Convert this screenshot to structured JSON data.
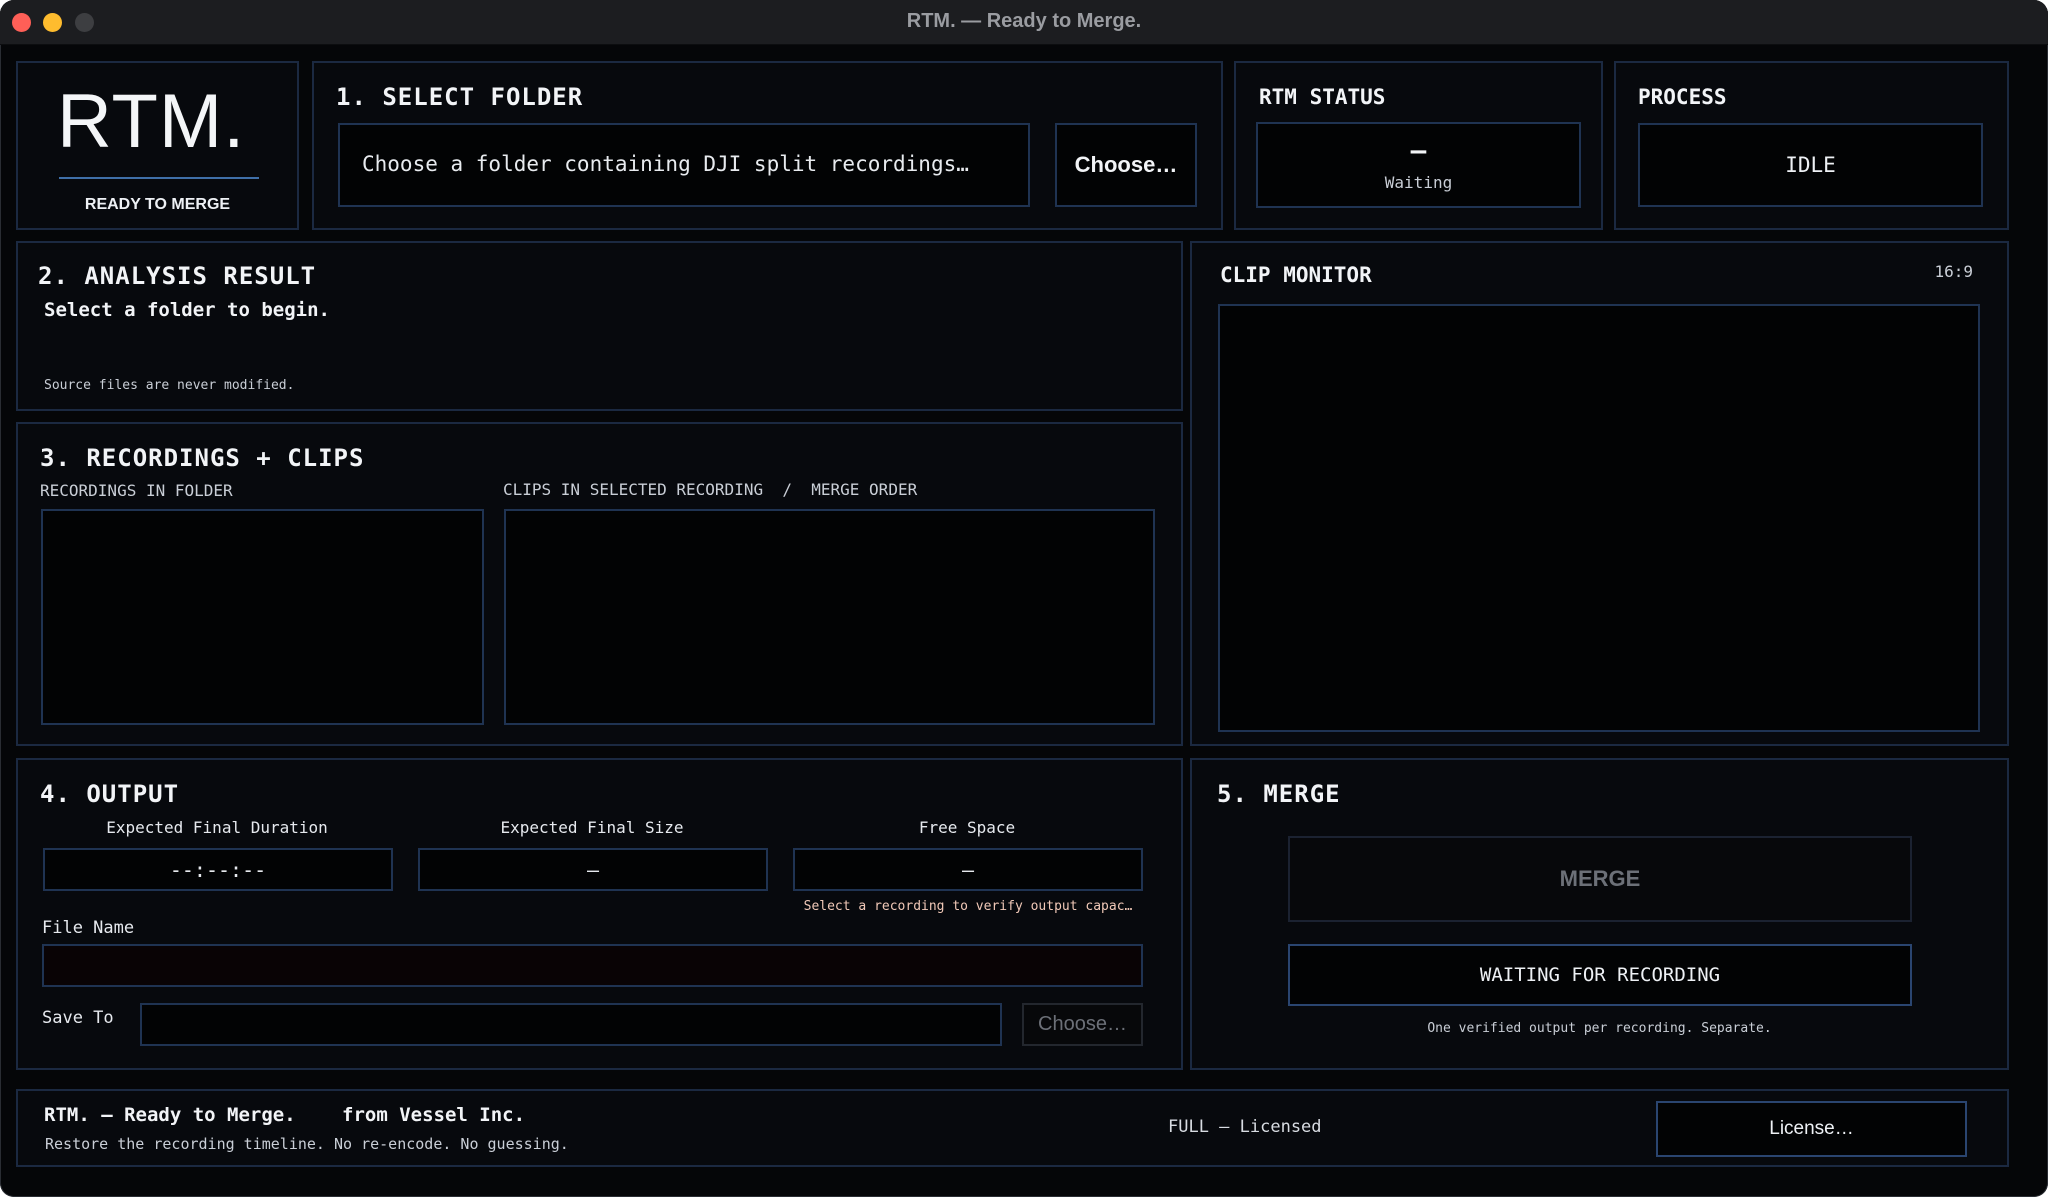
{
  "window": {
    "title": "RTM. — Ready to Merge."
  },
  "logo": {
    "wordmark": "RTM.",
    "tagline": "READY TO MERGE"
  },
  "select_folder": {
    "title": "1. SELECT FOLDER",
    "placeholder": "Choose a folder containing DJI split recordings…",
    "choose_label": "Choose…"
  },
  "rtm_status": {
    "title": "RTM STATUS",
    "value": "–",
    "caption": "Waiting"
  },
  "process": {
    "title": "PROCESS",
    "value": "IDLE"
  },
  "analysis": {
    "title": "2. ANALYSIS RESULT",
    "message": "Select a folder to begin.",
    "note": "Source files are never modified."
  },
  "clip_monitor": {
    "title": "CLIP MONITOR",
    "aspect": "16:9"
  },
  "recordings": {
    "title": "3. RECORDINGS + CLIPS",
    "recordings_label": "RECORDINGS IN FOLDER",
    "clips_label": "CLIPS IN SELECTED RECORDING  /  MERGE ORDER"
  },
  "output": {
    "title": "4. OUTPUT",
    "duration_label": "Expected Final Duration",
    "duration_value": "--:--:--",
    "size_label": "Expected Final Size",
    "size_value": "–",
    "free_label": "Free Space",
    "free_value": "–",
    "capacity_note": "Select a recording to verify output capac…",
    "filename_label": "File Name",
    "filename_value": "",
    "saveto_label": "Save To",
    "saveto_value": "",
    "choose_label": "Choose…"
  },
  "merge": {
    "title": "5. MERGE",
    "merge_label": "MERGE",
    "status_label": "WAITING FOR RECORDING",
    "note": "One verified output per recording. Separate."
  },
  "footer": {
    "product": "RTM. — Ready to Merge.",
    "company": "from Vessel Inc.",
    "tagline": "Restore the recording timeline. No re-encode. No guessing.",
    "license_status": "FULL — Licensed",
    "license_button": "License…"
  },
  "colors": {
    "background": "#050608",
    "panel_border": "#1b2941",
    "box_border": "#1f3352",
    "accent_blue": "#3f6fa8",
    "warning_text": "#f1c9b8"
  }
}
